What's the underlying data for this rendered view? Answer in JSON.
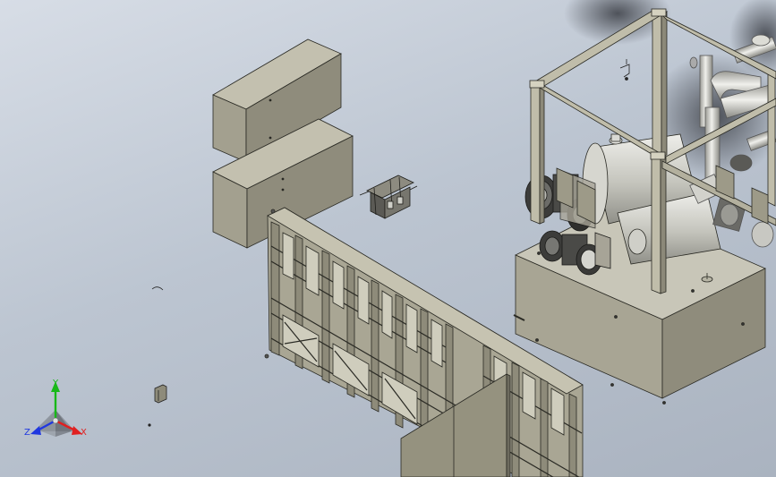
{
  "viewport": {
    "background_top": "#d7dde6",
    "background_bottom": "#aab3c0"
  },
  "colors": {
    "part_face_light": "#b8b5a4",
    "part_face_mid": "#a19e8c",
    "part_face_dark": "#8c897a",
    "edge": "#2a2a24",
    "metal_light": "#d9d9d4",
    "metal_mid": "#bdbdb5",
    "motor_dark": "#3c3c3a",
    "axis_x": "#e02020",
    "axis_y": "#18b818",
    "axis_z": "#2038e0"
  },
  "triad": {
    "x_label": "X",
    "y_label": "Y",
    "z_label": "Z",
    "icon": "coordinate-triad-icon"
  }
}
